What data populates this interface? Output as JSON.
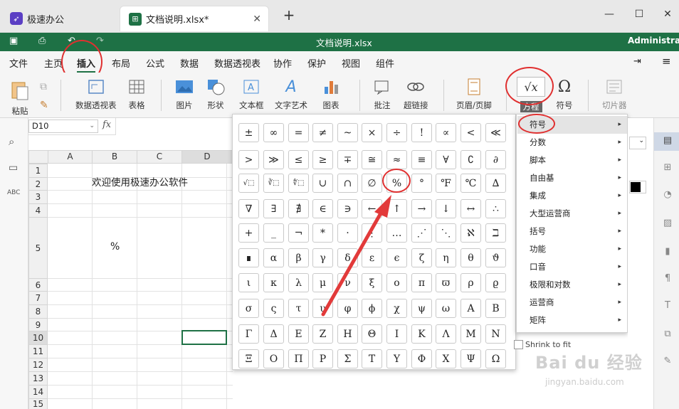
{
  "app_tab": {
    "label": "极速办公"
  },
  "doc_tab": {
    "label": "文档说明.xlsx*"
  },
  "window": {
    "title": "文档说明.xlsx",
    "user": "Administrator"
  },
  "menu": [
    "文件",
    "主页",
    "插入",
    "布局",
    "公式",
    "数据",
    "数据透视表",
    "协作",
    "保护",
    "视图",
    "组件"
  ],
  "ribbon": {
    "paste": "粘贴",
    "pivot": "数据透视表",
    "table": "表格",
    "image": "图片",
    "shape": "形状",
    "textbox": "文本框",
    "textart": "文字艺术",
    "chart": "图表",
    "comment": "批注",
    "hyperlink": "超链接",
    "header_footer": "页眉/页脚",
    "equation": "方程",
    "symbol": "符号",
    "slicer": "切片器"
  },
  "formula_bar": {
    "cell_ref": "D10",
    "fx": "fx"
  },
  "columns": [
    "A",
    "B",
    "C",
    "D"
  ],
  "rows": [
    "1",
    "2",
    "3",
    "4",
    "5",
    "6",
    "7",
    "8",
    "9",
    "10",
    "11",
    "12",
    "13",
    "14",
    "15"
  ],
  "cells": {
    "B2": "欢迎使用极速办公软件",
    "B5": "%"
  },
  "symbols": [
    [
      "±",
      "∞",
      "=",
      "≠",
      "~",
      "×",
      "÷",
      "!",
      "∝",
      "<",
      "≪"
    ],
    [
      ">",
      "≫",
      "≤",
      "≥",
      "∓",
      "≅",
      "≈",
      "≡",
      "∀",
      "∁",
      "∂"
    ],
    [
      "√⬚",
      "∛⬚",
      "∜⬚",
      "∪",
      "∩",
      "∅",
      "%",
      "°",
      "℉",
      "℃",
      "∆"
    ],
    [
      "∇",
      "∃",
      "∄",
      "∈",
      "∋",
      "←",
      "↑",
      "→",
      "↓",
      "↔",
      "∴"
    ],
    [
      "+",
      "_",
      "¬",
      "*",
      "·",
      "⋮",
      "…",
      "⋰",
      "⋱",
      "ℵ",
      "ℶ"
    ],
    [
      "∎",
      "α",
      "β",
      "γ",
      "δ",
      "ε",
      "ϵ",
      "ζ",
      "η",
      "θ",
      "ϑ"
    ],
    [
      "ι",
      "κ",
      "λ",
      "μ",
      "ν",
      "ξ",
      "ο",
      "π",
      "ϖ",
      "ρ",
      "ϱ"
    ],
    [
      "σ",
      "ς",
      "τ",
      "υ",
      "φ",
      "ϕ",
      "χ",
      "ψ",
      "ω",
      "Α",
      "Β"
    ],
    [
      "Γ",
      "Δ",
      "Ε",
      "Ζ",
      "Η",
      "Θ",
      "Ι",
      "Κ",
      "Λ",
      "Μ",
      "Ν"
    ],
    [
      "Ξ",
      "Ο",
      "Π",
      "Ρ",
      "Σ",
      "Τ",
      "Υ",
      "Φ",
      "Χ",
      "Ψ",
      "Ω"
    ]
  ],
  "submenu": [
    "符号",
    "分数",
    "脚本",
    "自由基",
    "集成",
    "大型运营商",
    "括号",
    "功能",
    "口音",
    "极限和对数",
    "运营商",
    "矩阵"
  ],
  "right_panel": {
    "shrink": "Shrink to fit"
  },
  "watermark": {
    "brand": "Bai du 经验",
    "url": "jingyan.baidu.com"
  },
  "colors": {
    "green": "#1e7145",
    "highlight_ring": "#e03030",
    "arrow": "#e23a3a"
  }
}
